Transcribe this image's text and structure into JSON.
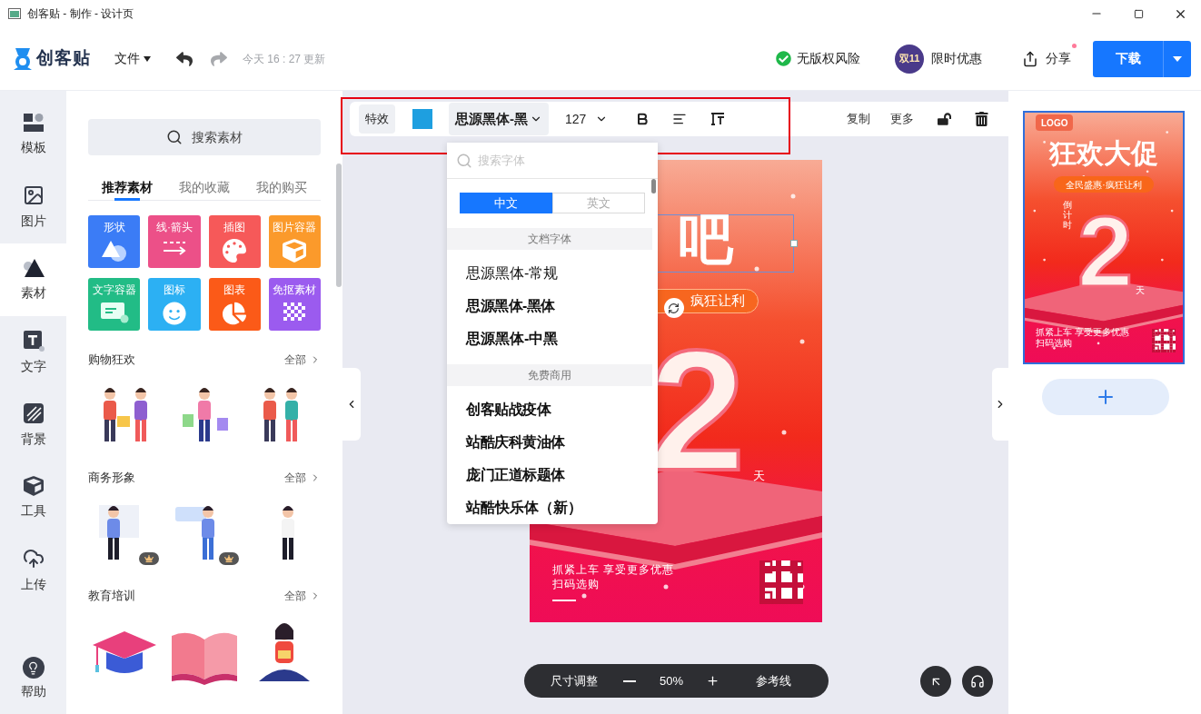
{
  "window": {
    "title": "创客贴 - 制作 - 设计页"
  },
  "header": {
    "logo": "创客贴",
    "file_menu": "文件",
    "redo_disabled": true,
    "saved_status": "今天 16 : 27 更新",
    "copyright": "无版权风险",
    "promo": "限时优惠",
    "promo_badge": "双11",
    "share": "分享",
    "share_dot": true,
    "download": "下载"
  },
  "rail": {
    "items": [
      {
        "label": "模板",
        "selected": false
      },
      {
        "label": "图片",
        "selected": false
      },
      {
        "label": "素材",
        "selected": true
      },
      {
        "label": "文字",
        "selected": false
      },
      {
        "label": "背景",
        "selected": false
      },
      {
        "label": "工具",
        "selected": false
      },
      {
        "label": "上传",
        "selected": false
      }
    ],
    "help": "帮助"
  },
  "materials": {
    "search": "搜索素材",
    "tabs": [
      {
        "label": "推荐素材",
        "selected": true
      },
      {
        "label": "我的收藏",
        "selected": false
      },
      {
        "label": "我的购买",
        "selected": false
      }
    ],
    "categories": [
      {
        "label": "形状",
        "color": "#3b7cf6"
      },
      {
        "label": "线·箭头",
        "color": "#ec5088"
      },
      {
        "label": "插图",
        "color": "#f65959"
      },
      {
        "label": "图片容器",
        "color": "#fb9a2b"
      },
      {
        "label": "文字容器",
        "color": "#22bc86"
      },
      {
        "label": "图标",
        "color": "#2cb0f3"
      },
      {
        "label": "图表",
        "color": "#fb5a18"
      },
      {
        "label": "免抠素材",
        "color": "#9b5bef"
      }
    ],
    "sections": [
      {
        "title": "购物狂欢",
        "more": "全部",
        "items": [
          {
            "premium": false
          },
          {
            "premium": false
          },
          {
            "premium": false
          }
        ]
      },
      {
        "title": "商务形象",
        "more": "全部",
        "items": [
          {
            "premium": true
          },
          {
            "premium": true
          },
          {
            "premium": false
          }
        ]
      },
      {
        "title": "教育培训",
        "more": "全部",
        "items": [
          {
            "premium": false
          },
          {
            "premium": false
          },
          {
            "premium": false
          }
        ]
      }
    ]
  },
  "toolbar": {
    "effects": "特效",
    "color": "#1e9fe0",
    "font": "思源黑体-黑",
    "size": "127",
    "actions": [
      "复制",
      "更多"
    ]
  },
  "font_menu": {
    "search_placeholder": "搜索字体",
    "tabs": [
      {
        "label": "中文",
        "selected": true
      },
      {
        "label": "英文",
        "selected": false
      }
    ],
    "groups": [
      {
        "title": "文档字体",
        "fonts": [
          {
            "name": "思源黑体-常规",
            "kind": "regular"
          },
          {
            "name": "思源黑体-黑体",
            "kind": "heavy"
          },
          {
            "name": "思源黑体-中黑",
            "kind": "bold"
          }
        ]
      },
      {
        "title": "免费商用",
        "fonts": [
          {
            "name": "创客贴战疫体",
            "kind": "heavy"
          },
          {
            "name": "站酷庆科黄油体",
            "kind": "heavy"
          },
          {
            "name": "庞门正道标题体",
            "kind": "heavy"
          },
          {
            "name": "站酷快乐体（新）",
            "kind": "bold"
          }
        ]
      }
    ]
  },
  "poster": {
    "heading": "吧",
    "tagline": "疯狂让利",
    "number": "2",
    "unit": "天",
    "footer": [
      "抓紧上车 享受更多优惠",
      "扫码选购"
    ]
  },
  "zoom_bar": {
    "resize": "尺寸调整",
    "zoom": "50%",
    "guides": "参考线"
  },
  "pages": [
    {
      "selected": true,
      "logo": "LOGO",
      "heading": "狂欢大促",
      "tagline": "全民盛惠·疯狂让利",
      "countdown": "倒计时",
      "number": "2",
      "unit": "天",
      "footer": [
        "抓紧上车 享受更多优惠",
        "扫码选购"
      ]
    }
  ]
}
